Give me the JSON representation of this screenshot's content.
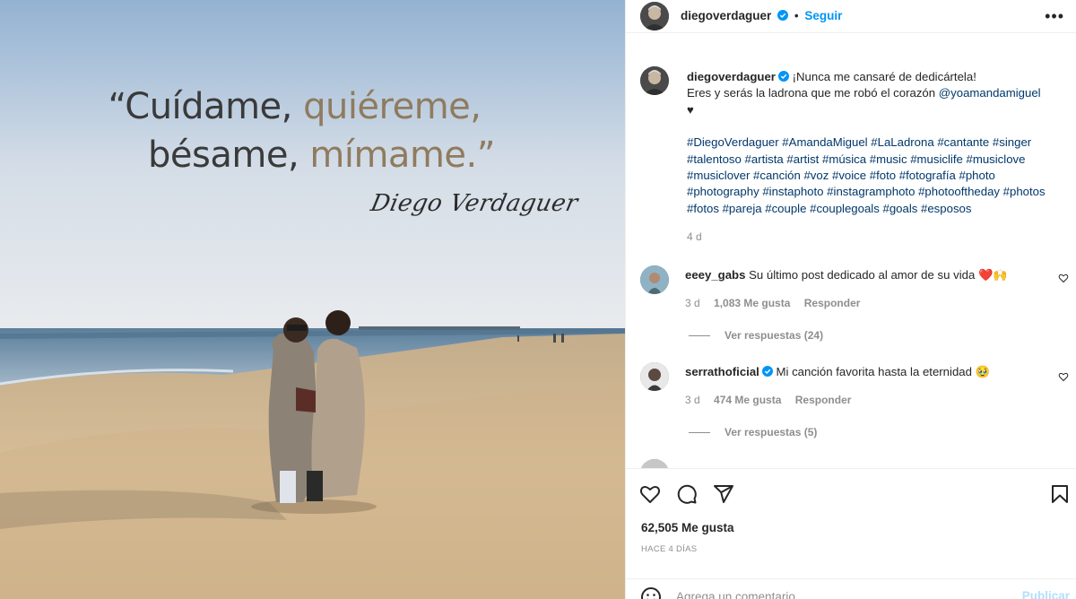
{
  "post": {
    "quote_line1_a": "“Cuídame,",
    "quote_line1_b": "quiéreme,",
    "quote_line2_a": "bésame,",
    "quote_line2_b": "mímame.”",
    "signature": "Diego Verdaguer"
  },
  "header": {
    "username": "diegoverdaguer",
    "follow_label": "Seguir",
    "more_label": "•••"
  },
  "caption": {
    "username": "diegoverdaguer",
    "line1": "¡Nunca me cansaré de dedicártela!",
    "line2": "Eres y serás la ladrona que me robó el corazón",
    "mention": "@yoamandamiguel",
    "heart": "♥",
    "hashtags": "#DiegoVerdaguer #AmandaMiguel #LaLadrona #cantante #singer #talentoso #artista #artist #música #music #musiclife #musiclove #musiclover #canción #voz #voice #foto #fotografía #photo #photography #instaphoto #instagramphoto #photooftheday #photos #fotos #pareja #couple #couplegoals #goals #esposos",
    "time": "4 d"
  },
  "comments": [
    {
      "username": "eeey_gabs",
      "text": "Su último post dedicado al amor de su vida",
      "emoji": "❤️🙌",
      "time": "3 d",
      "likes": "1,083 Me gusta",
      "reply_label": "Responder",
      "view_replies": "Ver respuestas (24)"
    },
    {
      "username": "serrathoficial",
      "text": "Mi canción favorita hasta la eternidad",
      "emoji": "🥹",
      "time": "3 d",
      "likes": "474 Me gusta",
      "reply_label": "Responder",
      "view_replies": "Ver respuestas (5)"
    }
  ],
  "actions": {
    "icons": [
      "heart-icon",
      "comment-icon",
      "share-icon",
      "bookmark-icon"
    ],
    "likes": "62,505 Me gusta",
    "date": "HACE 4 DÍAS"
  },
  "composer": {
    "placeholder": "Agrega un comentario...",
    "publish_label": "Publicar",
    "emoji_icon": "smiley-icon"
  },
  "colors": {
    "accent": "#0095f6",
    "link": "#00376b",
    "muted": "#8e8e8e",
    "publish_disabled": "#b2dffc",
    "heart_red": "#ed4956"
  }
}
